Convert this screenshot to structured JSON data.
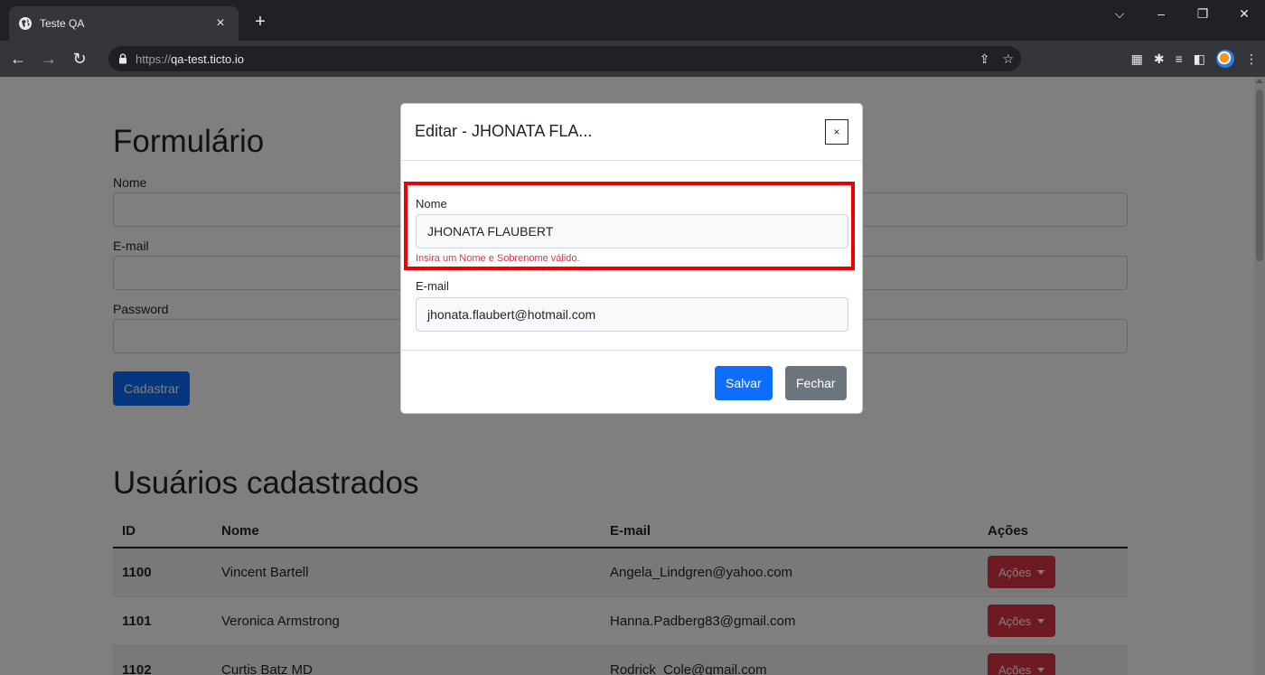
{
  "browser": {
    "tab_title": "Teste QA",
    "url_scheme": "https://",
    "url_host": "qa-test.ticto.io"
  },
  "form": {
    "heading": "Formulário",
    "nome_label": "Nome",
    "email_label": "E-mail",
    "password_label": "Password",
    "submit_label": "Cadastrar"
  },
  "users": {
    "heading": "Usuários cadastrados",
    "columns": [
      "ID",
      "Nome",
      "E-mail",
      "Ações"
    ],
    "rows": [
      {
        "id": "1100",
        "name": "Vincent Bartell",
        "email": "Angela_Lindgren@yahoo.com",
        "action": "Ações"
      },
      {
        "id": "1101",
        "name": "Veronica Armstrong",
        "email": "Hanna.Padberg83@gmail.com",
        "action": "Ações"
      },
      {
        "id": "1102",
        "name": "Curtis Batz MD",
        "email": "Rodrick_Cole@gmail.com",
        "action": "Ações"
      }
    ]
  },
  "modal": {
    "title": "Editar - JHONATA FLA...",
    "close_glyph": "×",
    "nome_label": "Nome",
    "nome_value": "JHONATA FLAUBERT",
    "nome_error": "Insira um Nome e Sobrenome válido.",
    "email_label": "E-mail",
    "email_value": "jhonata.flaubert@hotmail.com",
    "save_label": "Salvar",
    "close_label": "Fechar"
  },
  "colors": {
    "primary": "#0d6efd",
    "danger": "#dc3545",
    "secondary": "#6c757d",
    "highlight": "#ee0000"
  }
}
